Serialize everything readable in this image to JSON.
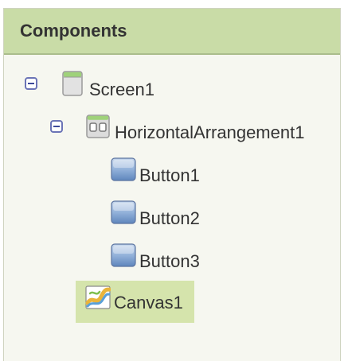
{
  "panel": {
    "title": "Components"
  },
  "tree": {
    "screen": {
      "label": "Screen1",
      "icon": "screen-icon",
      "expanded": true,
      "children": {
        "arrangement": {
          "label": "HorizontalArrangement1",
          "icon": "horizontal-arrangement-icon",
          "expanded": true,
          "children": [
            {
              "label": "Button1",
              "icon": "button-icon"
            },
            {
              "label": "Button2",
              "icon": "button-icon"
            },
            {
              "label": "Button3",
              "icon": "button-icon"
            }
          ]
        },
        "canvas": {
          "label": "Canvas1",
          "icon": "canvas-icon",
          "selected": true
        }
      }
    }
  },
  "colors": {
    "header_bg": "#c9dca7",
    "panel_bg": "#f6f7f0",
    "selected_bg": "#d5e4ac",
    "toggle_border": "#6b74b6"
  }
}
